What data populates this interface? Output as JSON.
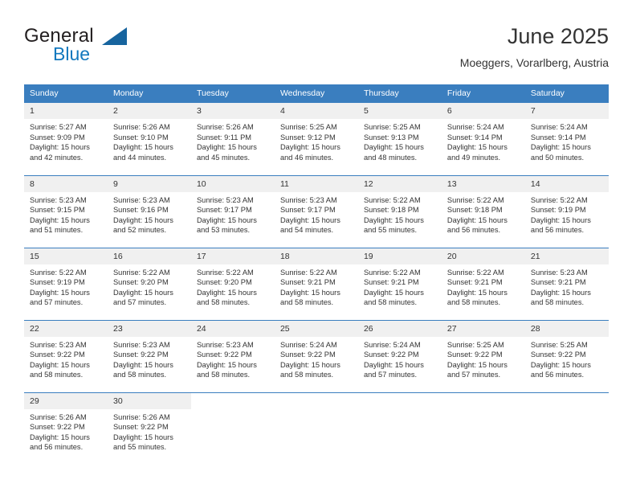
{
  "brand": {
    "name_part1": "General",
    "name_part2": "Blue",
    "logo_icon": "triangle-logo-icon",
    "color_primary": "#17649e",
    "color_secondary": "#1278be"
  },
  "header": {
    "title": "June 2025",
    "subtitle": "Moeggers, Vorarlberg, Austria"
  },
  "theme": {
    "header_row_bg": "#3a7ebf",
    "daynum_bg": "#f0f0f0",
    "text_color": "#333333"
  },
  "calendar": {
    "weekday_headers": [
      "Sunday",
      "Monday",
      "Tuesday",
      "Wednesday",
      "Thursday",
      "Friday",
      "Saturday"
    ],
    "weeks": [
      [
        {
          "day": "1",
          "sunrise": "Sunrise: 5:27 AM",
          "sunset": "Sunset: 9:09 PM",
          "daylight_line1": "Daylight: 15 hours",
          "daylight_line2": "and 42 minutes."
        },
        {
          "day": "2",
          "sunrise": "Sunrise: 5:26 AM",
          "sunset": "Sunset: 9:10 PM",
          "daylight_line1": "Daylight: 15 hours",
          "daylight_line2": "and 44 minutes."
        },
        {
          "day": "3",
          "sunrise": "Sunrise: 5:26 AM",
          "sunset": "Sunset: 9:11 PM",
          "daylight_line1": "Daylight: 15 hours",
          "daylight_line2": "and 45 minutes."
        },
        {
          "day": "4",
          "sunrise": "Sunrise: 5:25 AM",
          "sunset": "Sunset: 9:12 PM",
          "daylight_line1": "Daylight: 15 hours",
          "daylight_line2": "and 46 minutes."
        },
        {
          "day": "5",
          "sunrise": "Sunrise: 5:25 AM",
          "sunset": "Sunset: 9:13 PM",
          "daylight_line1": "Daylight: 15 hours",
          "daylight_line2": "and 48 minutes."
        },
        {
          "day": "6",
          "sunrise": "Sunrise: 5:24 AM",
          "sunset": "Sunset: 9:14 PM",
          "daylight_line1": "Daylight: 15 hours",
          "daylight_line2": "and 49 minutes."
        },
        {
          "day": "7",
          "sunrise": "Sunrise: 5:24 AM",
          "sunset": "Sunset: 9:14 PM",
          "daylight_line1": "Daylight: 15 hours",
          "daylight_line2": "and 50 minutes."
        }
      ],
      [
        {
          "day": "8",
          "sunrise": "Sunrise: 5:23 AM",
          "sunset": "Sunset: 9:15 PM",
          "daylight_line1": "Daylight: 15 hours",
          "daylight_line2": "and 51 minutes."
        },
        {
          "day": "9",
          "sunrise": "Sunrise: 5:23 AM",
          "sunset": "Sunset: 9:16 PM",
          "daylight_line1": "Daylight: 15 hours",
          "daylight_line2": "and 52 minutes."
        },
        {
          "day": "10",
          "sunrise": "Sunrise: 5:23 AM",
          "sunset": "Sunset: 9:17 PM",
          "daylight_line1": "Daylight: 15 hours",
          "daylight_line2": "and 53 minutes."
        },
        {
          "day": "11",
          "sunrise": "Sunrise: 5:23 AM",
          "sunset": "Sunset: 9:17 PM",
          "daylight_line1": "Daylight: 15 hours",
          "daylight_line2": "and 54 minutes."
        },
        {
          "day": "12",
          "sunrise": "Sunrise: 5:22 AM",
          "sunset": "Sunset: 9:18 PM",
          "daylight_line1": "Daylight: 15 hours",
          "daylight_line2": "and 55 minutes."
        },
        {
          "day": "13",
          "sunrise": "Sunrise: 5:22 AM",
          "sunset": "Sunset: 9:18 PM",
          "daylight_line1": "Daylight: 15 hours",
          "daylight_line2": "and 56 minutes."
        },
        {
          "day": "14",
          "sunrise": "Sunrise: 5:22 AM",
          "sunset": "Sunset: 9:19 PM",
          "daylight_line1": "Daylight: 15 hours",
          "daylight_line2": "and 56 minutes."
        }
      ],
      [
        {
          "day": "15",
          "sunrise": "Sunrise: 5:22 AM",
          "sunset": "Sunset: 9:19 PM",
          "daylight_line1": "Daylight: 15 hours",
          "daylight_line2": "and 57 minutes."
        },
        {
          "day": "16",
          "sunrise": "Sunrise: 5:22 AM",
          "sunset": "Sunset: 9:20 PM",
          "daylight_line1": "Daylight: 15 hours",
          "daylight_line2": "and 57 minutes."
        },
        {
          "day": "17",
          "sunrise": "Sunrise: 5:22 AM",
          "sunset": "Sunset: 9:20 PM",
          "daylight_line1": "Daylight: 15 hours",
          "daylight_line2": "and 58 minutes."
        },
        {
          "day": "18",
          "sunrise": "Sunrise: 5:22 AM",
          "sunset": "Sunset: 9:21 PM",
          "daylight_line1": "Daylight: 15 hours",
          "daylight_line2": "and 58 minutes."
        },
        {
          "day": "19",
          "sunrise": "Sunrise: 5:22 AM",
          "sunset": "Sunset: 9:21 PM",
          "daylight_line1": "Daylight: 15 hours",
          "daylight_line2": "and 58 minutes."
        },
        {
          "day": "20",
          "sunrise": "Sunrise: 5:22 AM",
          "sunset": "Sunset: 9:21 PM",
          "daylight_line1": "Daylight: 15 hours",
          "daylight_line2": "and 58 minutes."
        },
        {
          "day": "21",
          "sunrise": "Sunrise: 5:23 AM",
          "sunset": "Sunset: 9:21 PM",
          "daylight_line1": "Daylight: 15 hours",
          "daylight_line2": "and 58 minutes."
        }
      ],
      [
        {
          "day": "22",
          "sunrise": "Sunrise: 5:23 AM",
          "sunset": "Sunset: 9:22 PM",
          "daylight_line1": "Daylight: 15 hours",
          "daylight_line2": "and 58 minutes."
        },
        {
          "day": "23",
          "sunrise": "Sunrise: 5:23 AM",
          "sunset": "Sunset: 9:22 PM",
          "daylight_line1": "Daylight: 15 hours",
          "daylight_line2": "and 58 minutes."
        },
        {
          "day": "24",
          "sunrise": "Sunrise: 5:23 AM",
          "sunset": "Sunset: 9:22 PM",
          "daylight_line1": "Daylight: 15 hours",
          "daylight_line2": "and 58 minutes."
        },
        {
          "day": "25",
          "sunrise": "Sunrise: 5:24 AM",
          "sunset": "Sunset: 9:22 PM",
          "daylight_line1": "Daylight: 15 hours",
          "daylight_line2": "and 58 minutes."
        },
        {
          "day": "26",
          "sunrise": "Sunrise: 5:24 AM",
          "sunset": "Sunset: 9:22 PM",
          "daylight_line1": "Daylight: 15 hours",
          "daylight_line2": "and 57 minutes."
        },
        {
          "day": "27",
          "sunrise": "Sunrise: 5:25 AM",
          "sunset": "Sunset: 9:22 PM",
          "daylight_line1": "Daylight: 15 hours",
          "daylight_line2": "and 57 minutes."
        },
        {
          "day": "28",
          "sunrise": "Sunrise: 5:25 AM",
          "sunset": "Sunset: 9:22 PM",
          "daylight_line1": "Daylight: 15 hours",
          "daylight_line2": "and 56 minutes."
        }
      ],
      [
        {
          "day": "29",
          "sunrise": "Sunrise: 5:26 AM",
          "sunset": "Sunset: 9:22 PM",
          "daylight_line1": "Daylight: 15 hours",
          "daylight_line2": "and 56 minutes."
        },
        {
          "day": "30",
          "sunrise": "Sunrise: 5:26 AM",
          "sunset": "Sunset: 9:22 PM",
          "daylight_line1": "Daylight: 15 hours",
          "daylight_line2": "and 55 minutes."
        },
        null,
        null,
        null,
        null,
        null
      ]
    ]
  }
}
